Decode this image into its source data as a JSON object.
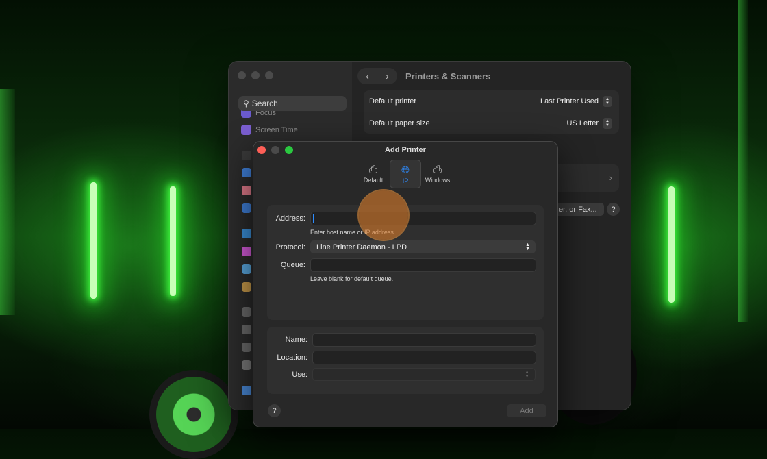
{
  "settings_window": {
    "title": "Printers & Scanners",
    "search_placeholder": "Search",
    "sidebar_items": [
      {
        "label": "Focus",
        "icon": "moon-icon",
        "color": "#6a5acd"
      },
      {
        "label": "Screen Time",
        "icon": "hourglass-icon",
        "color": "#7b5fd1"
      }
    ],
    "rows": [
      {
        "label": "Default printer",
        "value": "Last Printer Used"
      },
      {
        "label": "Default paper size",
        "value": "US Letter"
      }
    ],
    "fax_button_label": "er, or Fax...",
    "help_label": "?"
  },
  "dialog": {
    "title": "Add Printer",
    "tabs": [
      {
        "label": "Default",
        "icon": "printer-icon",
        "active": false
      },
      {
        "label": "IP",
        "icon": "globe-icon",
        "active": true
      },
      {
        "label": "Windows",
        "icon": "windows-printer-icon",
        "active": false
      }
    ],
    "address": {
      "label": "Address:",
      "value": "",
      "hint": "Enter host name or IP address."
    },
    "protocol": {
      "label": "Protocol:",
      "value": "Line Printer Daemon - LPD"
    },
    "queue": {
      "label": "Queue:",
      "value": "",
      "hint": "Leave blank for default queue."
    },
    "name": {
      "label": "Name:",
      "value": ""
    },
    "location": {
      "label": "Location:",
      "value": ""
    },
    "use": {
      "label": "Use:",
      "value": ""
    },
    "help_label": "?",
    "add_label": "Add"
  },
  "colors": {
    "accent": "#2d8cff",
    "close": "#fe5f57",
    "zoom": "#2ac840",
    "cursor_highlight": "#d67a2c"
  }
}
